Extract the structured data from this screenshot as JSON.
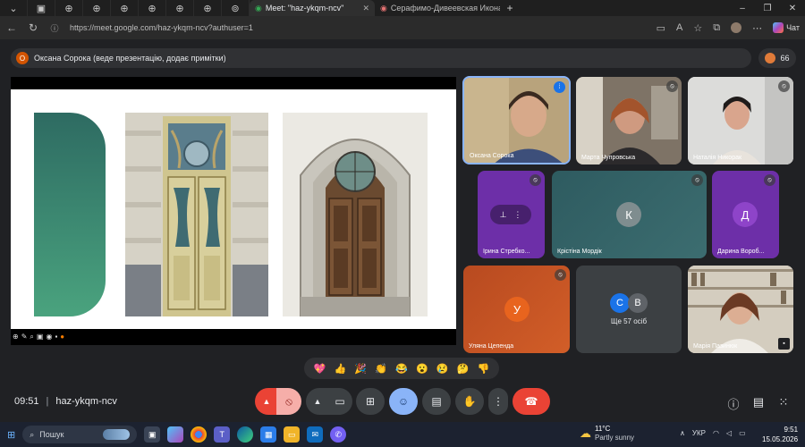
{
  "browser": {
    "tabs": [
      {
        "title": "Meet: \"haz-ykqm-ncv\"",
        "active": true
      },
      {
        "title": "Серафимо-Дивеевская Икона Бо...",
        "active": false
      }
    ],
    "url": "https://meet.google.com/haz-ykqm-ncv?authuser=1",
    "chat_label": "Чат"
  },
  "meet": {
    "presenter_text": "Оксана Сорока (веде презентацію, додає примітки)",
    "presenter_initial": "О",
    "people_count": "66",
    "meeting_time": "09:51",
    "meeting_code": "haz-ykqm-ncv",
    "participants": [
      {
        "name": "Оксана Сорока",
        "type": "video",
        "muted": false
      },
      {
        "name": "Марта Чупровська",
        "type": "video",
        "muted": true
      },
      {
        "name": "Наталія Никорак",
        "type": "video",
        "muted": true
      },
      {
        "name": "Ірина Стребко...",
        "type": "avatar",
        "muted": true
      },
      {
        "name": "Крістіна Мордік",
        "type": "avatar",
        "initial": "К",
        "muted": true
      },
      {
        "name": "Дарина Вороб...",
        "type": "avatar",
        "initial": "Д",
        "muted": true
      },
      {
        "name": "Уляна Цепенда",
        "type": "avatar",
        "initial": "У",
        "muted": true
      },
      {
        "name": "Ще 57 осіб",
        "type": "group",
        "initials": [
          "С",
          "В"
        ]
      },
      {
        "name": "Марія Пазинюк",
        "type": "video",
        "muted": false
      }
    ],
    "reactions": [
      "💖",
      "👍",
      "🎉",
      "👏",
      "😂",
      "😮",
      "😢",
      "🤔",
      "👎"
    ]
  },
  "colors": {
    "meet_bg": "#202124",
    "mic_off_bg": "#f6aea9",
    "end_call": "#ea4335",
    "active_control": "#8ab4f8",
    "slide_green": "#3d8a72"
  },
  "taskbar": {
    "search_placeholder": "Пошук",
    "weather_temp": "11°C",
    "weather_cond": "Partly sunny",
    "lang": "УКР",
    "time": "9:51",
    "date": "15.05.2026"
  }
}
